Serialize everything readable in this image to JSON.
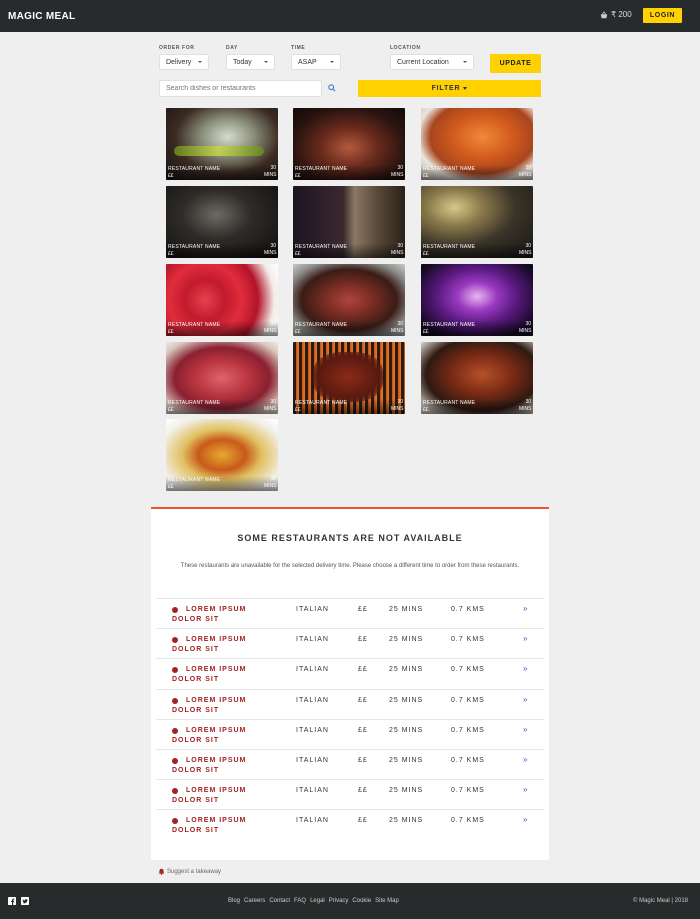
{
  "header": {
    "brand": "MAGIC MEAL",
    "wallet": "₹ 200",
    "login": "LOGIN"
  },
  "filters": {
    "order_for": {
      "label": "ORDER FOR",
      "value": "Delivery"
    },
    "day": {
      "label": "DAY",
      "value": "Today"
    },
    "time": {
      "label": "TIME",
      "value": "ASAP"
    },
    "location": {
      "label": "LOCATION",
      "value": "Current Location"
    },
    "update": "UPDATE",
    "search_placeholder": "Search dishes or restaurants",
    "filter": "FILTER"
  },
  "tiles": [
    {
      "name": "RESTAURANT NAME",
      "price": "££",
      "time_value": "30",
      "time_unit": "MINS"
    },
    {
      "name": "RESTAURANT NAME",
      "price": "££",
      "time_value": "30",
      "time_unit": "MINS"
    },
    {
      "name": "RESTAURANT NAME",
      "price": "££",
      "time_value": "30",
      "time_unit": "MINS"
    },
    {
      "name": "RESTAURANT NAME",
      "price": "££",
      "time_value": "30",
      "time_unit": "MINS"
    },
    {
      "name": "RESTAURANT NAME",
      "price": "££",
      "time_value": "30",
      "time_unit": "MINS"
    },
    {
      "name": "RESTAURANT NAME",
      "price": "££",
      "time_value": "30",
      "time_unit": "MINS"
    },
    {
      "name": "RESTAURANT NAME",
      "price": "££",
      "time_value": "30",
      "time_unit": "MINS"
    },
    {
      "name": "RESTAURANT NAME",
      "price": "££",
      "time_value": "30",
      "time_unit": "MINS"
    },
    {
      "name": "RESTAURANT NAME",
      "price": "££",
      "time_value": "30",
      "time_unit": "MINS"
    },
    {
      "name": "RESTAURANT NAME",
      "price": "££",
      "time_value": "30",
      "time_unit": "MINS"
    },
    {
      "name": "RESTAURANT NAME",
      "price": "££",
      "time_value": "30",
      "time_unit": "MINS"
    },
    {
      "name": "RESTAURANT NAME",
      "price": "££",
      "time_value": "30",
      "time_unit": "MINS"
    },
    {
      "name": "RESTAURANT NAME",
      "price": "££",
      "time_value": "30",
      "time_unit": "MINS"
    }
  ],
  "unavailable": {
    "title": "SOME RESTAURANTS ARE NOT AVAILABLE",
    "subtitle": "These restaurants are unavailable for the selected delivery time. Please choose a different time to order from these restaurants.",
    "rows": [
      {
        "name": "LOREM IPSUM DOLOR SIT",
        "cuisine": "ITALIAN",
        "price": "££",
        "time": "25 MINS",
        "distance": "0.7 KMS",
        "go": "»"
      },
      {
        "name": "LOREM IPSUM DOLOR SIT",
        "cuisine": "ITALIAN",
        "price": "££",
        "time": "25 MINS",
        "distance": "0.7 KMS",
        "go": "»"
      },
      {
        "name": "LOREM IPSUM DOLOR SIT",
        "cuisine": "ITALIAN",
        "price": "££",
        "time": "25 MINS",
        "distance": "0.7 KMS",
        "go": "»"
      },
      {
        "name": "LOREM IPSUM DOLOR SIT",
        "cuisine": "ITALIAN",
        "price": "££",
        "time": "25 MINS",
        "distance": "0.7 KMS",
        "go": "»"
      },
      {
        "name": "LOREM IPSUM DOLOR SIT",
        "cuisine": "ITALIAN",
        "price": "££",
        "time": "25 MINS",
        "distance": "0.7 KMS",
        "go": "»"
      },
      {
        "name": "LOREM IPSUM DOLOR SIT",
        "cuisine": "ITALIAN",
        "price": "££",
        "time": "25 MINS",
        "distance": "0.7 KMS",
        "go": "»"
      },
      {
        "name": "LOREM IPSUM DOLOR SIT",
        "cuisine": "ITALIAN",
        "price": "££",
        "time": "25 MINS",
        "distance": "0.7 KMS",
        "go": "»"
      },
      {
        "name": "LOREM IPSUM DOLOR SIT",
        "cuisine": "ITALIAN",
        "price": "££",
        "time": "25 MINS",
        "distance": "0.7 KMS",
        "go": "»"
      }
    ]
  },
  "suggest": "Suggest a takeaway",
  "footer": {
    "links": [
      "Blog",
      "Careers",
      "Contact",
      "FAQ",
      "Legal",
      "Privacy",
      "Cookie",
      "Site Map"
    ],
    "copyright": "© Magic Meal | 2018"
  },
  "colors": {
    "accent": "#ffd100",
    "header_bg": "#272b2b",
    "danger": "#a32222",
    "panel_border": "#e8572a"
  }
}
